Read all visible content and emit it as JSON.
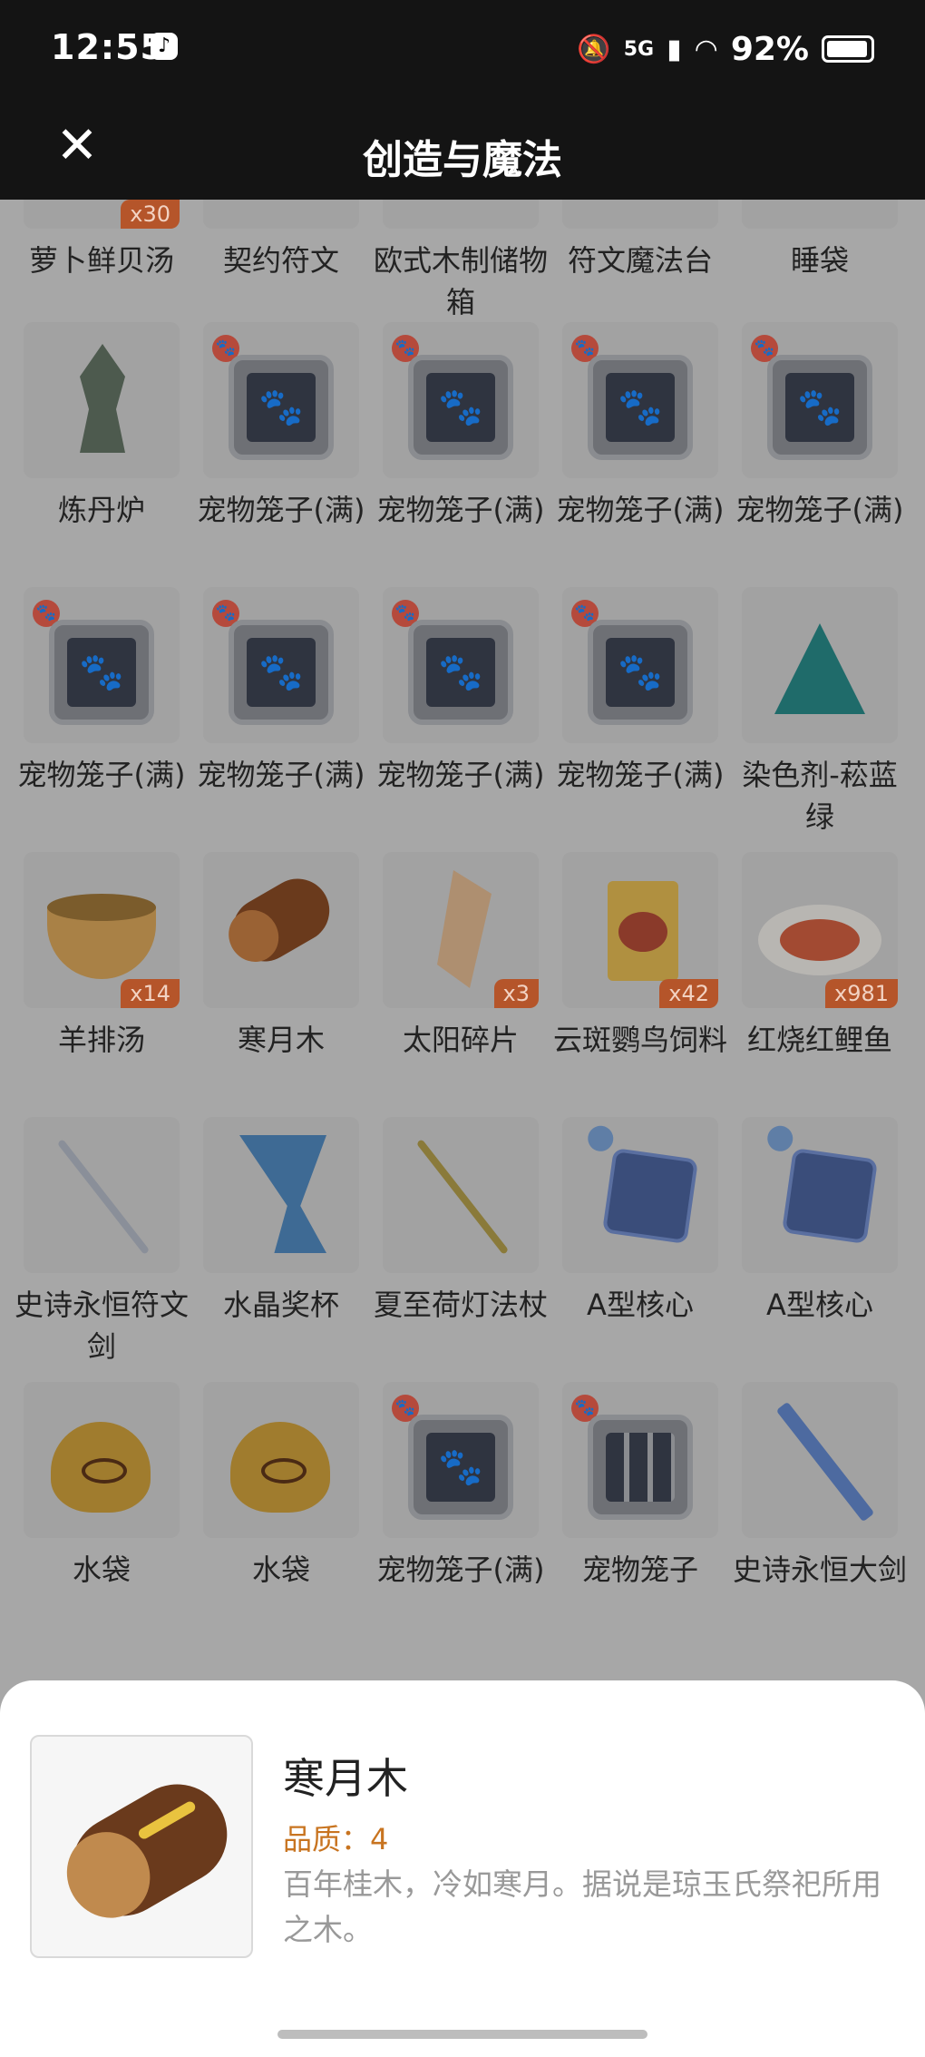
{
  "status": {
    "time": "12:55",
    "battery": "92%",
    "network": "5G"
  },
  "header": {
    "title": "创造与魔法"
  },
  "items": [
    {
      "name": "萝卜鲜贝汤",
      "art": "soup",
      "badge": "x30"
    },
    {
      "name": "契约符文",
      "art": "none",
      "badge": ""
    },
    {
      "name": "欧式木制储物箱",
      "art": "none",
      "badge": ""
    },
    {
      "name": "符文魔法台",
      "art": "none",
      "badge": ""
    },
    {
      "name": "睡袋",
      "art": "none",
      "badge": ""
    },
    {
      "name": "炼丹炉",
      "art": "lantern",
      "badge": ""
    },
    {
      "name": "宠物笼子(满)",
      "art": "cage",
      "badge": ""
    },
    {
      "name": "宠物笼子(满)",
      "art": "cage",
      "badge": ""
    },
    {
      "name": "宠物笼子(满)",
      "art": "cage",
      "badge": ""
    },
    {
      "name": "宠物笼子(满)",
      "art": "cage",
      "badge": ""
    },
    {
      "name": "宠物笼子(满)",
      "art": "cage",
      "badge": ""
    },
    {
      "name": "宠物笼子(满)",
      "art": "cage",
      "badge": ""
    },
    {
      "name": "宠物笼子(满)",
      "art": "cage",
      "badge": ""
    },
    {
      "name": "宠物笼子(满)",
      "art": "cage",
      "badge": ""
    },
    {
      "name": "染色剂-菘蓝绿",
      "art": "flask",
      "badge": ""
    },
    {
      "name": "羊排汤",
      "art": "soup",
      "badge": "x14"
    },
    {
      "name": "寒月木",
      "art": "log",
      "badge": ""
    },
    {
      "name": "太阳碎片",
      "art": "shard",
      "badge": "x3"
    },
    {
      "name": "云斑鹦鸟饲料",
      "art": "bag",
      "badge": "x42"
    },
    {
      "name": "红烧红鲤鱼",
      "art": "plate",
      "badge": "x981"
    },
    {
      "name": "史诗永恒符文剑",
      "art": "stick",
      "badge": ""
    },
    {
      "name": "水晶奖杯",
      "art": "trophy",
      "badge": ""
    },
    {
      "name": "夏至荷灯法杖",
      "art": "stick-gold",
      "badge": ""
    },
    {
      "name": "A型核心",
      "art": "cube",
      "badge": ""
    },
    {
      "name": "A型核心",
      "art": "cube",
      "badge": ""
    },
    {
      "name": "水袋",
      "art": "pouch",
      "badge": ""
    },
    {
      "name": "水袋",
      "art": "pouch",
      "badge": ""
    },
    {
      "name": "宠物笼子(满)",
      "art": "cage",
      "badge": ""
    },
    {
      "name": "宠物笼子",
      "art": "cage-empty",
      "badge": ""
    },
    {
      "name": "史诗永恒大剑",
      "art": "stick-blue",
      "badge": ""
    }
  ],
  "detail": {
    "name": "寒月木",
    "quality": "品质：4",
    "description": "百年桂木，冷如寒月。据说是琼玉氏祭祀所用之木。"
  }
}
